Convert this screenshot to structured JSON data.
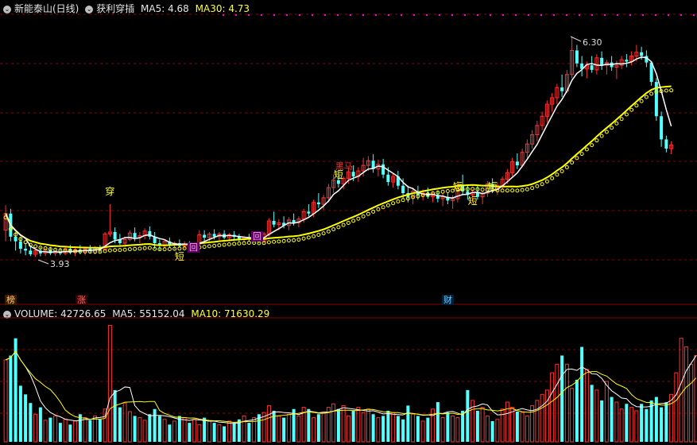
{
  "header": {
    "stock_name": "新能泰山(日线)",
    "indicator_name": "获利穿插",
    "ma5_label": "MA5: 4.68",
    "ma30_label": "MA30: 4.73"
  },
  "volume_header": {
    "label": "VOLUME: 42726.65",
    "ma5_label": "MA5: 55152.04",
    "ma10_label": "MA10: 71630.29"
  },
  "markers": {
    "chuan": "穿",
    "duan": "短",
    "hui": "回",
    "heima": "黑马",
    "high_label": "6.30",
    "low_label": "3.93"
  },
  "bottom_tags": {
    "bang": "榜",
    "zhang": "涨",
    "cai": "财"
  },
  "colors": {
    "up": "#ff3232",
    "down": "#54ffff",
    "ma_white": "#ffffff",
    "ma_yellow": "#ffff00",
    "text_yellow": "#ffff33",
    "grid": "#8b0000",
    "magenta": "#ff00ff"
  },
  "chart_data": [
    {
      "type": "candlestick",
      "title": "新能泰山(日线)",
      "series": [
        {
          "name": "MA5",
          "latest": 4.68
        },
        {
          "name": "MA30",
          "latest": 4.73
        }
      ],
      "annotations": [
        "6.30",
        "3.93"
      ],
      "ohlc": [
        [
          4.22,
          4.49,
          4.1,
          4.4
        ],
        [
          4.4,
          4.45,
          4.1,
          4.15
        ],
        [
          4.15,
          4.2,
          4.0,
          4.1
        ],
        [
          4.1,
          4.15,
          3.97,
          4.02
        ],
        [
          4.02,
          4.08,
          3.95,
          4.0
        ],
        [
          4.0,
          4.05,
          3.94,
          3.96
        ],
        [
          3.96,
          4.02,
          3.93,
          4.0
        ],
        [
          4.0,
          4.04,
          3.94,
          3.97
        ],
        [
          3.97,
          4.03,
          3.94,
          4.01
        ],
        [
          4.01,
          4.04,
          3.95,
          3.97
        ],
        [
          3.97,
          4.02,
          3.94,
          3.99
        ],
        [
          3.99,
          4.03,
          3.95,
          3.97
        ],
        [
          3.97,
          4.05,
          3.95,
          4.02
        ],
        [
          4.02,
          4.06,
          3.96,
          3.98
        ],
        [
          3.98,
          4.04,
          3.94,
          4.01
        ],
        [
          4.01,
          4.06,
          3.96,
          3.99
        ],
        [
          3.99,
          4.04,
          3.95,
          4.02
        ],
        [
          4.02,
          4.06,
          3.97,
          4.0
        ],
        [
          4.0,
          4.05,
          3.96,
          4.03
        ],
        [
          4.03,
          4.06,
          3.98,
          4.01
        ],
        [
          4.01,
          4.2,
          4.0,
          4.18
        ],
        [
          4.18,
          4.5,
          4.15,
          4.2
        ],
        [
          4.2,
          4.25,
          4.08,
          4.12
        ],
        [
          4.12,
          4.18,
          4.06,
          4.08
        ],
        [
          4.08,
          4.15,
          4.04,
          4.12
        ],
        [
          4.12,
          4.22,
          4.1,
          4.19
        ],
        [
          4.19,
          4.25,
          4.1,
          4.14
        ],
        [
          4.14,
          4.2,
          4.08,
          4.16
        ],
        [
          4.16,
          4.24,
          4.12,
          4.21
        ],
        [
          4.21,
          4.26,
          4.12,
          4.15
        ],
        [
          4.15,
          4.2,
          4.02,
          4.08
        ],
        [
          4.08,
          4.12,
          4.0,
          4.05
        ],
        [
          4.05,
          4.12,
          4.02,
          4.1
        ],
        [
          4.1,
          4.14,
          4.03,
          4.06
        ],
        [
          4.06,
          4.1,
          4.01,
          4.08
        ],
        [
          4.08,
          4.12,
          4.03,
          4.05
        ],
        [
          4.05,
          4.1,
          4.02,
          4.07
        ],
        [
          4.07,
          4.1,
          4.01,
          4.04
        ],
        [
          4.04,
          4.09,
          4.01,
          4.07
        ],
        [
          4.07,
          4.22,
          4.04,
          4.17
        ],
        [
          4.17,
          4.22,
          4.1,
          4.14
        ],
        [
          4.14,
          4.2,
          4.1,
          4.18
        ],
        [
          4.18,
          4.23,
          4.12,
          4.15
        ],
        [
          4.15,
          4.2,
          4.11,
          4.18
        ],
        [
          4.18,
          4.22,
          4.12,
          4.14
        ],
        [
          4.14,
          4.19,
          4.1,
          4.17
        ],
        [
          4.17,
          4.21,
          4.12,
          4.15
        ],
        [
          4.15,
          4.18,
          4.1,
          4.12
        ],
        [
          4.12,
          4.16,
          4.09,
          4.14
        ],
        [
          4.14,
          4.18,
          4.1,
          4.12
        ],
        [
          4.12,
          4.17,
          4.08,
          4.15
        ],
        [
          4.15,
          4.18,
          4.08,
          4.1
        ],
        [
          4.1,
          4.2,
          4.08,
          4.18
        ],
        [
          4.18,
          4.35,
          4.15,
          4.32
        ],
        [
          4.32,
          4.42,
          4.25,
          4.28
        ],
        [
          4.28,
          4.34,
          4.22,
          4.3
        ],
        [
          4.3,
          4.37,
          4.24,
          4.27
        ],
        [
          4.27,
          4.36,
          4.22,
          4.33
        ],
        [
          4.33,
          4.4,
          4.27,
          4.3
        ],
        [
          4.3,
          4.37,
          4.25,
          4.34
        ],
        [
          4.34,
          4.45,
          4.3,
          4.42
        ],
        [
          4.42,
          4.5,
          4.37,
          4.4
        ],
        [
          4.4,
          4.55,
          4.36,
          4.52
        ],
        [
          4.52,
          4.62,
          4.46,
          4.5
        ],
        [
          4.5,
          4.6,
          4.44,
          4.57
        ],
        [
          4.57,
          4.72,
          4.52,
          4.68
        ],
        [
          4.68,
          4.82,
          4.62,
          4.76
        ],
        [
          4.76,
          4.86,
          4.68,
          4.72
        ],
        [
          4.72,
          4.8,
          4.66,
          4.78
        ],
        [
          4.78,
          4.9,
          4.72,
          4.85
        ],
        [
          4.85,
          4.92,
          4.75,
          4.8
        ],
        [
          4.8,
          4.9,
          4.74,
          4.86
        ],
        [
          4.86,
          5.0,
          4.8,
          4.92
        ],
        [
          4.92,
          5.02,
          4.86,
          4.97
        ],
        [
          4.97,
          5.04,
          4.84,
          4.88
        ],
        [
          4.88,
          4.98,
          4.8,
          4.93
        ],
        [
          4.93,
          4.99,
          4.78,
          4.82
        ],
        [
          4.82,
          4.9,
          4.7,
          4.74
        ],
        [
          4.74,
          4.84,
          4.68,
          4.8
        ],
        [
          4.8,
          4.86,
          4.66,
          4.7
        ],
        [
          4.7,
          4.78,
          4.56,
          4.62
        ],
        [
          4.62,
          4.7,
          4.52,
          4.58
        ],
        [
          4.58,
          4.68,
          4.5,
          4.64
        ],
        [
          4.64,
          4.7,
          4.55,
          4.6
        ],
        [
          4.6,
          4.66,
          4.54,
          4.62
        ],
        [
          4.62,
          4.68,
          4.56,
          4.58
        ],
        [
          4.58,
          4.64,
          4.52,
          4.6
        ],
        [
          4.6,
          4.65,
          4.52,
          4.56
        ],
        [
          4.56,
          4.62,
          4.48,
          4.58
        ],
        [
          4.58,
          4.62,
          4.5,
          4.54
        ],
        [
          4.54,
          4.6,
          4.45,
          4.56
        ],
        [
          4.56,
          4.75,
          4.52,
          4.7
        ],
        [
          4.7,
          4.82,
          4.6,
          4.64
        ],
        [
          4.64,
          4.7,
          4.55,
          4.6
        ],
        [
          4.6,
          4.66,
          4.52,
          4.63
        ],
        [
          4.63,
          4.7,
          4.55,
          4.58
        ],
        [
          4.58,
          4.64,
          4.5,
          4.62
        ],
        [
          4.62,
          4.75,
          4.58,
          4.72
        ],
        [
          4.72,
          4.78,
          4.62,
          4.68
        ],
        [
          4.68,
          4.74,
          4.6,
          4.7
        ],
        [
          4.7,
          4.8,
          4.66,
          4.77
        ],
        [
          4.77,
          4.88,
          4.72,
          4.84
        ],
        [
          4.84,
          5.0,
          4.8,
          4.96
        ],
        [
          4.96,
          5.05,
          4.88,
          4.92
        ],
        [
          4.92,
          5.1,
          4.9,
          5.06
        ],
        [
          5.06,
          5.2,
          5.0,
          5.15
        ],
        [
          5.15,
          5.3,
          5.1,
          5.25
        ],
        [
          5.25,
          5.4,
          5.18,
          5.35
        ],
        [
          5.35,
          5.5,
          5.3,
          5.45
        ],
        [
          5.45,
          5.62,
          5.38,
          5.58
        ],
        [
          5.58,
          5.7,
          5.5,
          5.65
        ],
        [
          5.65,
          5.8,
          5.58,
          5.76
        ],
        [
          5.76,
          5.9,
          5.66,
          5.72
        ],
        [
          5.72,
          5.95,
          5.7,
          5.9
        ],
        [
          5.9,
          6.3,
          5.86,
          6.16
        ],
        [
          6.16,
          6.22,
          5.98,
          6.02
        ],
        [
          6.02,
          6.1,
          5.88,
          5.96
        ],
        [
          5.96,
          6.04,
          5.86,
          6.0
        ],
        [
          6.0,
          6.1,
          5.92,
          5.95
        ],
        [
          5.95,
          6.12,
          5.9,
          6.08
        ],
        [
          6.08,
          6.15,
          5.95,
          6.0
        ],
        [
          6.0,
          6.06,
          5.9,
          6.03
        ],
        [
          6.03,
          6.1,
          5.94,
          5.98
        ],
        [
          5.98,
          6.05,
          5.85,
          6.0
        ],
        [
          6.0,
          6.1,
          5.96,
          6.06
        ],
        [
          6.06,
          6.12,
          5.98,
          6.04
        ],
        [
          6.04,
          6.15,
          6.0,
          6.1
        ],
        [
          6.1,
          6.22,
          6.04,
          6.14
        ],
        [
          6.14,
          6.2,
          6.06,
          6.1
        ],
        [
          6.1,
          6.16,
          5.98,
          6.03
        ],
        [
          6.03,
          6.0,
          5.78,
          5.82
        ],
        [
          5.82,
          5.86,
          5.4,
          5.45
        ],
        [
          5.45,
          5.5,
          5.12,
          5.2
        ],
        [
          5.2,
          5.24,
          5.06,
          5.1
        ],
        [
          5.1,
          5.18,
          5.04,
          5.14
        ]
      ]
    },
    {
      "type": "bar",
      "title": "VOLUME",
      "series": [
        {
          "name": "VOLUME",
          "latest": 42726.65
        },
        {
          "name": "MA5",
          "latest": 55152.04
        },
        {
          "name": "MA10",
          "latest": 71630.29
        }
      ],
      "values": [
        95000,
        100000,
        120000,
        65000,
        55000,
        45000,
        32000,
        40000,
        25000,
        28000,
        30000,
        22000,
        26000,
        20000,
        24000,
        32000,
        28000,
        25000,
        30000,
        26000,
        38000,
        135000,
        60000,
        40000,
        45000,
        35000,
        30000,
        28000,
        25000,
        32000,
        38000,
        30000,
        26000,
        20000,
        24000,
        30000,
        28000,
        22000,
        26000,
        20000,
        28000,
        24000,
        22000,
        20000,
        18000,
        24000,
        22000,
        26000,
        30000,
        22000,
        28000,
        32000,
        34000,
        42000,
        36000,
        30000,
        28000,
        32000,
        38000,
        30000,
        40000,
        38000,
        28000,
        32000,
        34000,
        40000,
        44000,
        38000,
        42000,
        30000,
        36000,
        40000,
        34000,
        38000,
        32000,
        28000,
        30000,
        36000,
        34000,
        30000,
        26000,
        42000,
        32000,
        30000,
        24000,
        28000,
        38000,
        46000,
        28000,
        34000,
        30000,
        28000,
        36000,
        60000,
        48000,
        36000,
        40000,
        30000,
        24000,
        26000,
        38000,
        46000,
        40000,
        35000,
        34000,
        30000,
        42000,
        48000,
        55000,
        60000,
        80000,
        90000,
        100000,
        90000,
        62000,
        72000,
        110000,
        84000,
        66000,
        60000,
        48000,
        70000,
        52000,
        46000,
        38000,
        44000,
        40000,
        36000,
        44000,
        38000,
        48000,
        52000,
        40000,
        46000,
        55000,
        80000,
        120000,
        110000,
        90000,
        100000
      ]
    }
  ]
}
